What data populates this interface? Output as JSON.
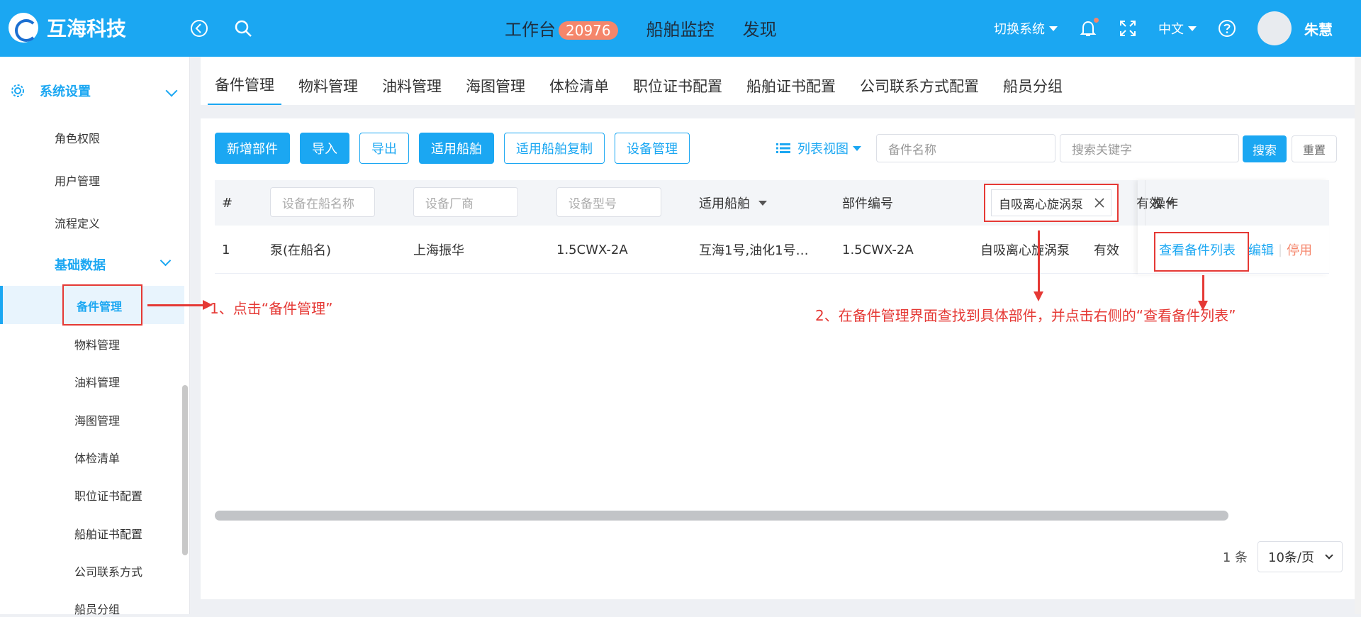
{
  "header": {
    "brand": "互海科技",
    "nav": [
      {
        "label": "工作台",
        "badge": "20976"
      },
      {
        "label": "船舶监控"
      },
      {
        "label": "发现"
      }
    ],
    "switch_system": "切换系统",
    "language": "中文",
    "user_name": "朱慧"
  },
  "sidebar": {
    "group": "系统设置",
    "items": [
      "角色权限",
      "用户管理",
      "流程定义"
    ],
    "sub_group": "基础数据",
    "sub_items": [
      "备件管理",
      "物料管理",
      "油料管理",
      "海图管理",
      "体检清单",
      "职位证书配置",
      "船舶证书配置",
      "公司联系方式",
      "船员分组"
    ]
  },
  "tabs": [
    "备件管理",
    "物料管理",
    "油料管理",
    "海图管理",
    "体检清单",
    "职位证书配置",
    "船舶证书配置",
    "公司联系方式配置",
    "船员分组"
  ],
  "toolbar": {
    "add": "新增部件",
    "import": "导入",
    "export": "导出",
    "apply_ship": "适用船舶",
    "copy_ship": "适用船舶复制",
    "device": "设备管理",
    "view": "列表视图",
    "name_placeholder": "备件名称",
    "keyword_placeholder": "搜索关键字",
    "search": "搜索",
    "reset": "重置"
  },
  "table": {
    "headers": {
      "index": "#",
      "onboard_name_placeholder": "设备在船名称",
      "maker_placeholder": "设备厂商",
      "model_placeholder": "设备型号",
      "ships": "适用船舶",
      "part_no": "部件编号",
      "part_filter": "自吸离心旋涡泵",
      "status": "有效",
      "ops": "操作"
    },
    "rows": [
      {
        "index": "1",
        "onboard_name": "泵(在船名)",
        "maker": "上海振华",
        "model": "1.5CWX-2A",
        "ships": "互海1号,油化1号…",
        "part_no": "1.5CWX-2A",
        "part_name": "自吸离心旋涡泵",
        "status": "有效",
        "op_view": "查看备件列表",
        "op_edit": "编辑",
        "op_disable": "停用"
      }
    ]
  },
  "pager": {
    "total": "1 条",
    "page_size": "10条/页"
  },
  "annotations": {
    "step1": "1、点击“备件管理”",
    "step2": "2、在备件管理界面查找到具体部件，并点击右侧的“查看备件列表”"
  },
  "colors": {
    "primary": "#1ba7f2",
    "annotation": "#e53935",
    "badge": "#f5866b"
  }
}
